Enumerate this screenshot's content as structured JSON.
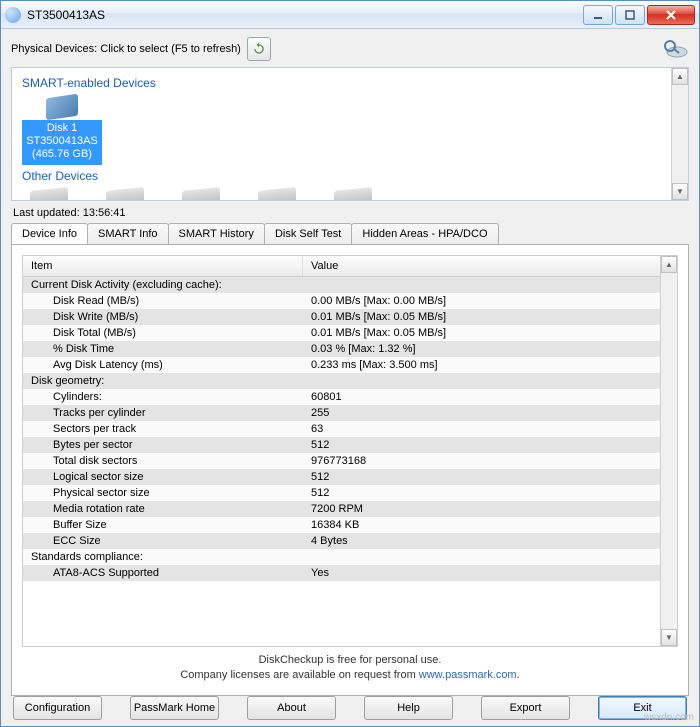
{
  "window": {
    "title": "ST3500413AS"
  },
  "toolbar": {
    "physical_label": "Physical Devices: Click to select (F5 to refresh)",
    "last_updated": "Last updated: 13:56:41"
  },
  "devices": {
    "smart_header": "SMART-enabled Devices",
    "other_header": "Other Devices",
    "selected": {
      "name": "Disk 1",
      "model": "ST3500413AS",
      "size": "(465.76 GB)"
    }
  },
  "tabs": [
    {
      "label": "Device Info"
    },
    {
      "label": "SMART Info"
    },
    {
      "label": "SMART History"
    },
    {
      "label": "Disk Self Test"
    },
    {
      "label": "Hidden Areas - HPA/DCO"
    }
  ],
  "grid": {
    "col_item": "Item",
    "col_value": "Value",
    "rows": [
      {
        "item": "Current Disk Activity (excluding cache):",
        "value": "",
        "indent": false,
        "shade": "dk"
      },
      {
        "item": "Disk Read (MB/s)",
        "value": "0.00 MB/s  [Max: 0.00 MB/s]",
        "indent": true,
        "shade": "lt"
      },
      {
        "item": "Disk Write (MB/s)",
        "value": "0.01 MB/s  [Max: 0.05 MB/s]",
        "indent": true,
        "shade": "dk"
      },
      {
        "item": "Disk Total (MB/s)",
        "value": "0.01 MB/s  [Max: 0.05 MB/s]",
        "indent": true,
        "shade": "lt"
      },
      {
        "item": "% Disk Time",
        "value": "0.03 %    [Max: 1.32 %]",
        "indent": true,
        "shade": "dk"
      },
      {
        "item": "Avg Disk Latency (ms)",
        "value": "0.233 ms  [Max: 3.500 ms]",
        "indent": true,
        "shade": "lt"
      },
      {
        "item": "Disk geometry:",
        "value": "",
        "indent": false,
        "shade": "dk"
      },
      {
        "item": "Cylinders:",
        "value": "60801",
        "indent": true,
        "shade": "lt"
      },
      {
        "item": "Tracks per cylinder",
        "value": "255",
        "indent": true,
        "shade": "dk"
      },
      {
        "item": "Sectors per track",
        "value": "63",
        "indent": true,
        "shade": "lt"
      },
      {
        "item": "Bytes per sector",
        "value": "512",
        "indent": true,
        "shade": "dk"
      },
      {
        "item": "Total disk sectors",
        "value": "976773168",
        "indent": true,
        "shade": "lt"
      },
      {
        "item": "Logical sector size",
        "value": "512",
        "indent": true,
        "shade": "dk"
      },
      {
        "item": "Physical sector size",
        "value": "512",
        "indent": true,
        "shade": "lt"
      },
      {
        "item": "Media rotation rate",
        "value": "7200 RPM",
        "indent": true,
        "shade": "dk"
      },
      {
        "item": "Buffer Size",
        "value": "16384 KB",
        "indent": true,
        "shade": "lt"
      },
      {
        "item": "ECC Size",
        "value": "4 Bytes",
        "indent": true,
        "shade": "dk"
      },
      {
        "item": "Standards compliance:",
        "value": "",
        "indent": false,
        "shade": "lt"
      },
      {
        "item": "ATA8-ACS Supported",
        "value": "Yes",
        "indent": true,
        "shade": "dk"
      }
    ]
  },
  "footer": {
    "line1": "DiskCheckup is free for personal use.",
    "line2a": "Company licenses are available on request from ",
    "link": "www.passmark.com",
    "line2b": "."
  },
  "buttons": {
    "config": "Configuration",
    "home": "PassMark Home",
    "about": "About",
    "help": "Help",
    "export": "Export",
    "exit": "Exit"
  },
  "watermark": "wsxdn.com"
}
